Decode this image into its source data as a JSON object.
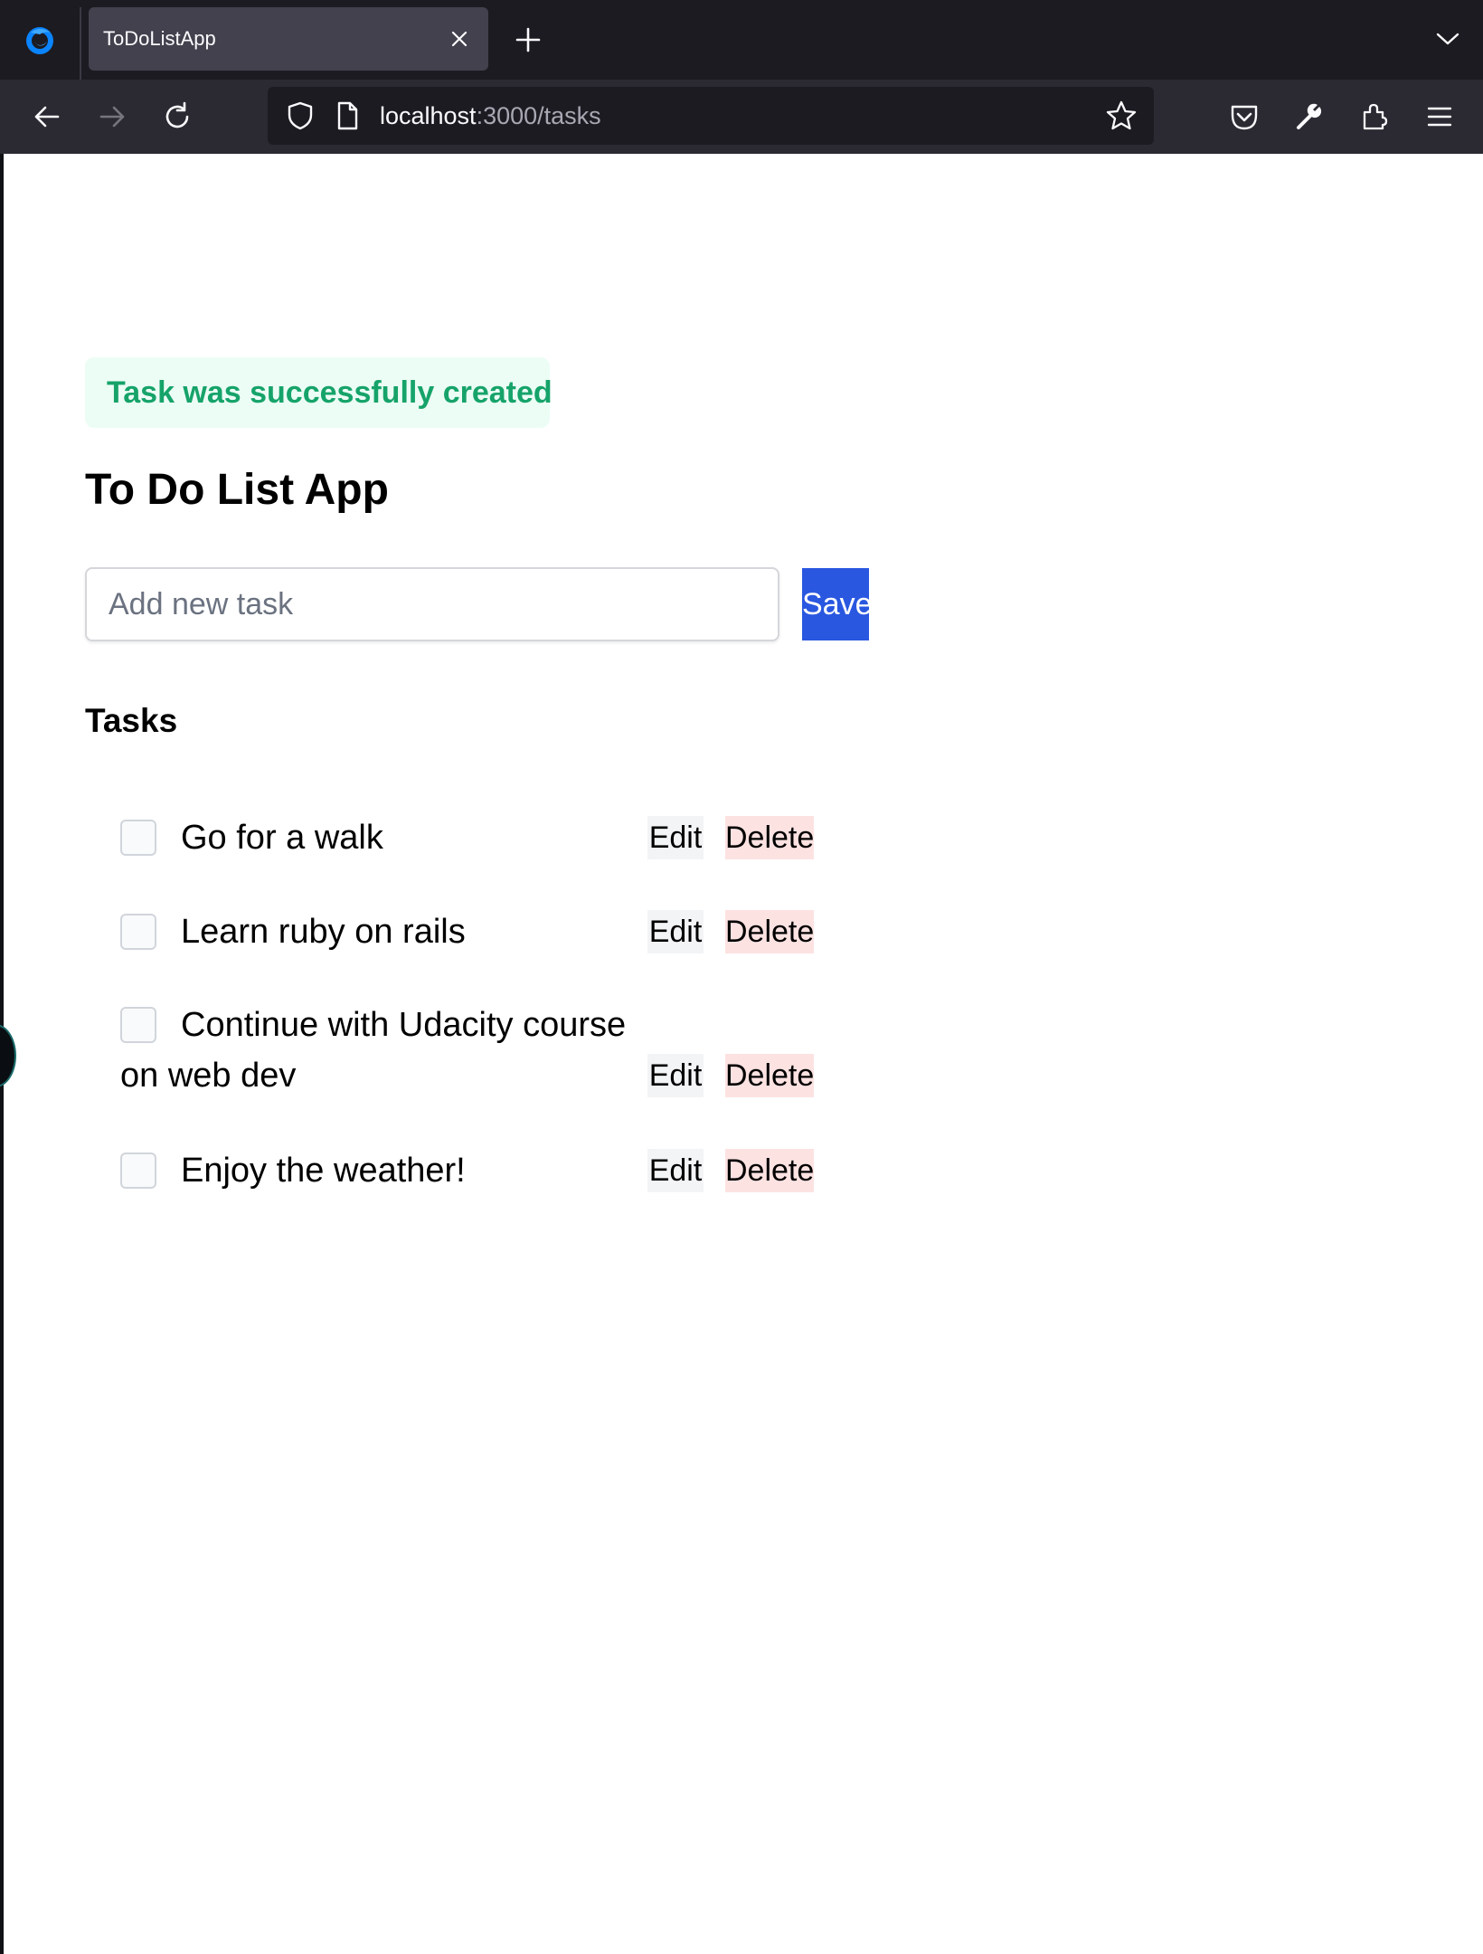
{
  "browser": {
    "tab_title": "ToDoListApp",
    "url_host": "localhost",
    "url_rest": ":3000/tasks"
  },
  "notice": {
    "text": "Task was successfully created"
  },
  "page": {
    "title": "To Do List App",
    "input_placeholder": "Add new task",
    "save_label": "Save",
    "tasks_heading": "Tasks"
  },
  "tasks": [
    {
      "text": "Go for a walk",
      "done": false,
      "edit_label": "Edit",
      "delete_label": "Delete"
    },
    {
      "text": "Learn ruby on rails",
      "done": false,
      "edit_label": "Edit",
      "delete_label": "Delete"
    },
    {
      "text": "Continue with Udacity course on web dev",
      "done": false,
      "edit_label": "Edit",
      "delete_label": "Delete"
    },
    {
      "text": "Enjoy the weather!",
      "done": false,
      "edit_label": "Edit",
      "delete_label": "Delete"
    }
  ],
  "colors": {
    "notice_bg": "#ecfdf5",
    "notice_text": "#16a36a",
    "save_bg": "#2957e0",
    "edit_bg": "#f3f4f6",
    "delete_bg": "#fde2e2"
  }
}
